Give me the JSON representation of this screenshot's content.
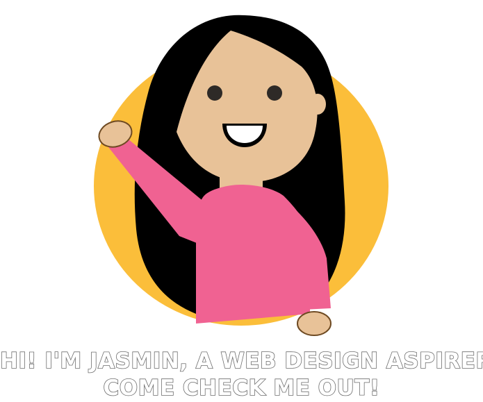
{
  "caption": {
    "line1": "HI! I'M JASMIN, A WEB DESIGN ASPIRER.",
    "line2": "COME CHECK ME OUT!"
  },
  "illustration": {
    "subject": "waving-girl-avatar",
    "colors": {
      "backdrop": "#FBBE3A",
      "hair": "#000000",
      "skin": "#E8C298",
      "skin_outline": "#6E4A22",
      "eyes": "#2E2A27",
      "mouth": "#000000",
      "teeth": "#FFFFFF",
      "shirt": "#F06292"
    }
  }
}
